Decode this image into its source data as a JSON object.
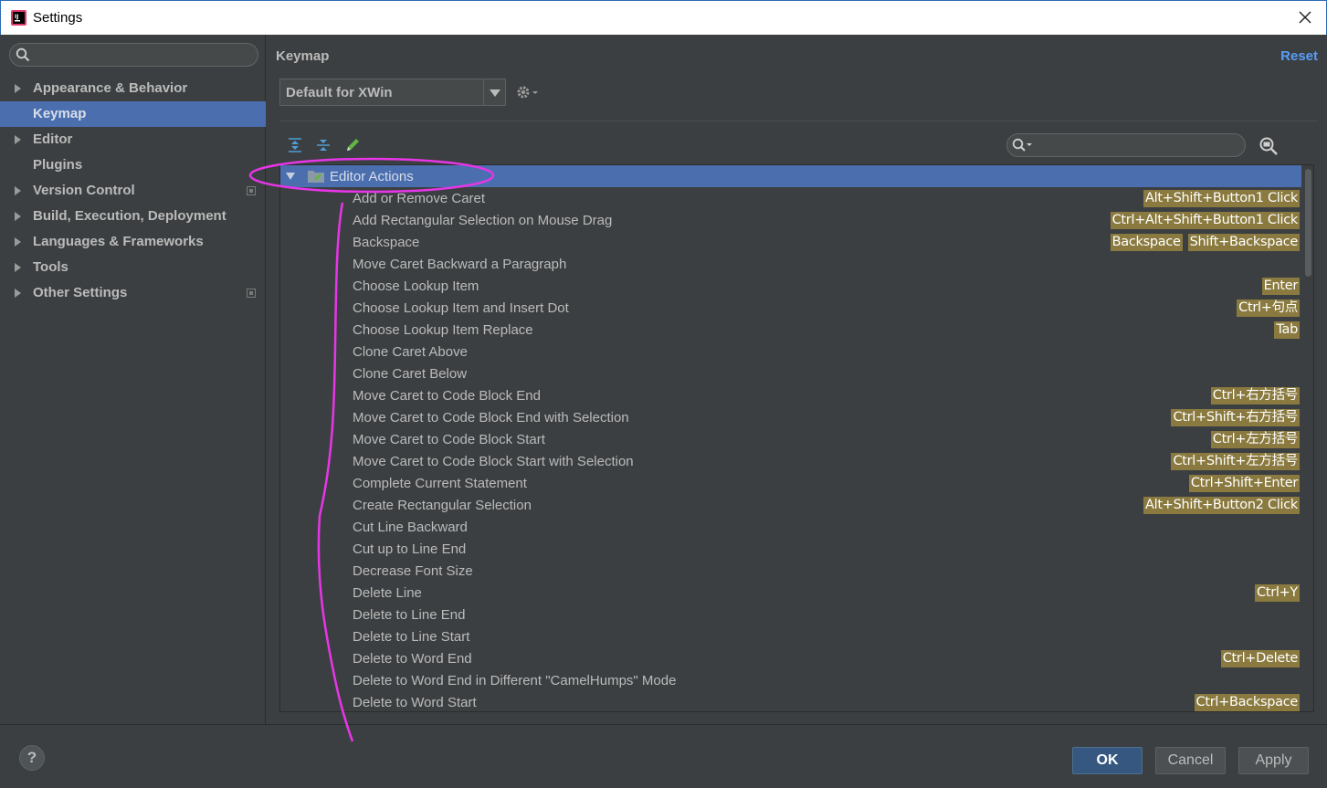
{
  "window": {
    "title": "Settings"
  },
  "sidebar": {
    "search_placeholder": "",
    "items": [
      {
        "label": "Appearance & Behavior",
        "expandable": true,
        "selected": false,
        "project_icon": false
      },
      {
        "label": "Keymap",
        "expandable": false,
        "selected": true,
        "project_icon": false
      },
      {
        "label": "Editor",
        "expandable": true,
        "selected": false,
        "project_icon": false
      },
      {
        "label": "Plugins",
        "expandable": false,
        "selected": false,
        "project_icon": false
      },
      {
        "label": "Version Control",
        "expandable": true,
        "selected": false,
        "project_icon": true
      },
      {
        "label": "Build, Execution, Deployment",
        "expandable": true,
        "selected": false,
        "project_icon": false
      },
      {
        "label": "Languages & Frameworks",
        "expandable": true,
        "selected": false,
        "project_icon": false
      },
      {
        "label": "Tools",
        "expandable": true,
        "selected": false,
        "project_icon": false
      },
      {
        "label": "Other Settings",
        "expandable": true,
        "selected": false,
        "project_icon": true
      }
    ]
  },
  "main": {
    "title": "Keymap",
    "reset_label": "Reset",
    "keymap_selected": "Default for XWin",
    "toolbar_icons": [
      "expand-all-icon",
      "collapse-all-icon",
      "edit-shortcut-icon"
    ],
    "filter_placeholder": "",
    "tree": {
      "group_label": "Editor Actions",
      "rows": [
        {
          "name": "Add or Remove Caret",
          "keys": [
            "Alt+Shift+Button1 Click"
          ]
        },
        {
          "name": "Add Rectangular Selection on Mouse Drag",
          "keys": [
            "Ctrl+Alt+Shift+Button1 Click"
          ]
        },
        {
          "name": "Backspace",
          "keys": [
            "Backspace",
            "Shift+Backspace"
          ]
        },
        {
          "name": "Move Caret Backward a Paragraph",
          "keys": []
        },
        {
          "name": "Choose Lookup Item",
          "keys": [
            "Enter"
          ]
        },
        {
          "name": "Choose Lookup Item and Insert Dot",
          "keys": [
            "Ctrl+句点"
          ]
        },
        {
          "name": "Choose Lookup Item Replace",
          "keys": [
            "Tab"
          ]
        },
        {
          "name": "Clone Caret Above",
          "keys": []
        },
        {
          "name": "Clone Caret Below",
          "keys": []
        },
        {
          "name": "Move Caret to Code Block End",
          "keys": [
            "Ctrl+右方括号"
          ]
        },
        {
          "name": "Move Caret to Code Block End with Selection",
          "keys": [
            "Ctrl+Shift+右方括号"
          ]
        },
        {
          "name": "Move Caret to Code Block Start",
          "keys": [
            "Ctrl+左方括号"
          ]
        },
        {
          "name": "Move Caret to Code Block Start with Selection",
          "keys": [
            "Ctrl+Shift+左方括号"
          ]
        },
        {
          "name": "Complete Current Statement",
          "keys": [
            "Ctrl+Shift+Enter"
          ]
        },
        {
          "name": "Create Rectangular Selection",
          "keys": [
            "Alt+Shift+Button2 Click"
          ]
        },
        {
          "name": "Cut Line Backward",
          "keys": []
        },
        {
          "name": "Cut up to Line End",
          "keys": []
        },
        {
          "name": "Decrease Font Size",
          "keys": []
        },
        {
          "name": "Delete Line",
          "keys": [
            "Ctrl+Y"
          ]
        },
        {
          "name": "Delete to Line End",
          "keys": []
        },
        {
          "name": "Delete to Line Start",
          "keys": []
        },
        {
          "name": "Delete to Word End",
          "keys": [
            "Ctrl+Delete"
          ]
        },
        {
          "name": "Delete to Word End in Different \"CamelHumps\" Mode",
          "keys": []
        },
        {
          "name": "Delete to Word Start",
          "keys": [
            "Ctrl+Backspace"
          ]
        }
      ]
    }
  },
  "footer": {
    "help_label": "?",
    "ok_label": "OK",
    "cancel_label": "Cancel",
    "apply_label": "Apply"
  },
  "colors": {
    "selection": "#4b6eaf",
    "shortcut_badge": "#8a7a3f",
    "link": "#589df6",
    "annotation": "#e636e6"
  }
}
